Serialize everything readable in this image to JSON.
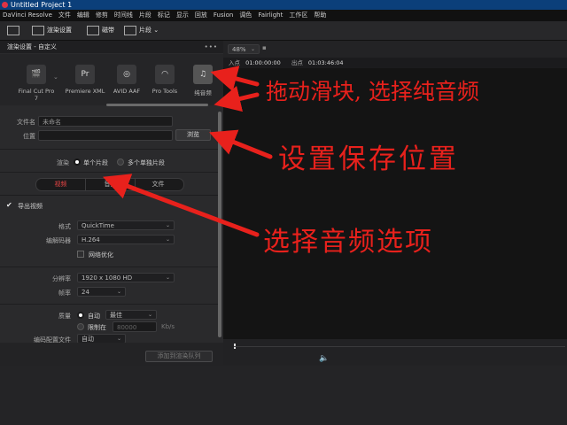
{
  "titlebar": {
    "title": "Untitled Project 1"
  },
  "menubar": {
    "items": [
      "DaVinci Resolve",
      "文件",
      "编辑",
      "修剪",
      "时间线",
      "片段",
      "标记",
      "显示",
      "回放",
      "Fusion",
      "调色",
      "Fairlight",
      "工作区",
      "帮助"
    ]
  },
  "toolbar": {
    "render_settings": "渲染设置",
    "media": "磁带",
    "clip": "片段"
  },
  "panel": {
    "header": "渲染设置 - 自定义",
    "dots": "•••"
  },
  "presets": [
    {
      "label": "Final Cut Pro 7",
      "glyph": "🎬"
    },
    {
      "label": "Premiere XML",
      "glyph": "Pr"
    },
    {
      "label": "AVID AAF",
      "glyph": "◎"
    },
    {
      "label": "Pro Tools",
      "glyph": "◠"
    },
    {
      "label": "纯音频",
      "glyph": "♫"
    }
  ],
  "file": {
    "filename_label": "文件名",
    "filename_value": "未命名",
    "location_label": "位置",
    "location_value": "",
    "browse_label": "浏览"
  },
  "render": {
    "label": "渲染",
    "single_clip": "单个片段",
    "multi_clip": "多个单独片段"
  },
  "tabs": [
    "视频",
    "音频",
    "文件"
  ],
  "video": {
    "export_video": "导出视频",
    "format_label": "格式",
    "format_value": "QuickTime",
    "codec_label": "编解码器",
    "codec_value": "H.264",
    "network_opt": "网络优化",
    "resolution_label": "分辨率",
    "resolution_value": "1920 x 1080 HD",
    "framerate_label": "帧率",
    "framerate_value": "24",
    "quality_label": "质量",
    "quality_auto": "自动",
    "quality_best": "最佳",
    "quality_limit": "限制在",
    "quality_limit_value": "80000",
    "quality_unit": "Kb/s",
    "encode_profile_label": "编码配置文件",
    "encode_profile_value": "自动"
  },
  "bottom": {
    "add_queue": "添加到渲染队列"
  },
  "viewer": {
    "zoom": "48%",
    "in_label": "入点",
    "in_value": "01:00:00:00",
    "out_label": "出点",
    "out_value": "01:03:46:04"
  },
  "annotations": {
    "drag_slider": "拖动滑块, 选择纯音频",
    "set_location": "设置保存位置",
    "select_audio": "选择音频选项"
  },
  "colors": {
    "annotation": "#e8211c",
    "titlebar": "#0b3f7a",
    "active_tab": "#e84545"
  }
}
